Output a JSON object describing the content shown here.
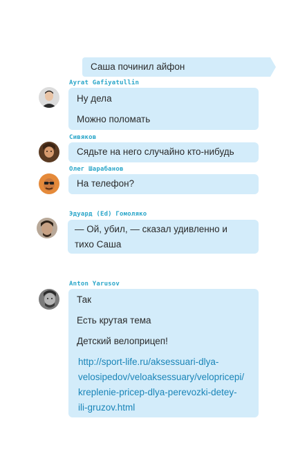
{
  "own_message": {
    "text": "Саша починил айфон"
  },
  "messages": [
    {
      "author": "Ayrat Gafiyatullin",
      "avatar_icon": "avatar-ayrat",
      "lines": [
        "Ну дела",
        "Можно поломать"
      ]
    },
    {
      "author": "Сивяков",
      "avatar_icon": "avatar-sivyakov",
      "lines": [
        "Сядьте на него случайно кто-нибудь"
      ]
    },
    {
      "author": "Олег Шарабанов",
      "avatar_icon": "avatar-oleg",
      "lines": [
        "На телефон?"
      ]
    },
    {
      "author": "Эдуард (Ed) Гомоляко",
      "avatar_icon": "avatar-eduard",
      "lines": [
        "— Ой, убил, — сказал удивленно и",
        "тихо Саша"
      ]
    },
    {
      "author": "Anton Yarusov",
      "avatar_icon": "avatar-anton",
      "lines": [
        "Так",
        "Есть крутая тема",
        "Детский велоприцеп!"
      ],
      "link_lines": [
        "http://sport-life.ru/aksessuari-dlya-",
        "velosipedov/veloaksessuary/velopricepi/",
        "kreplenie-pricep-dlya-perevozki-detey-",
        "ili-gruzov.html"
      ]
    }
  ],
  "colors": {
    "bubble": "#d3ecfa",
    "author": "#2aa6c9",
    "link": "#1a85b8"
  }
}
